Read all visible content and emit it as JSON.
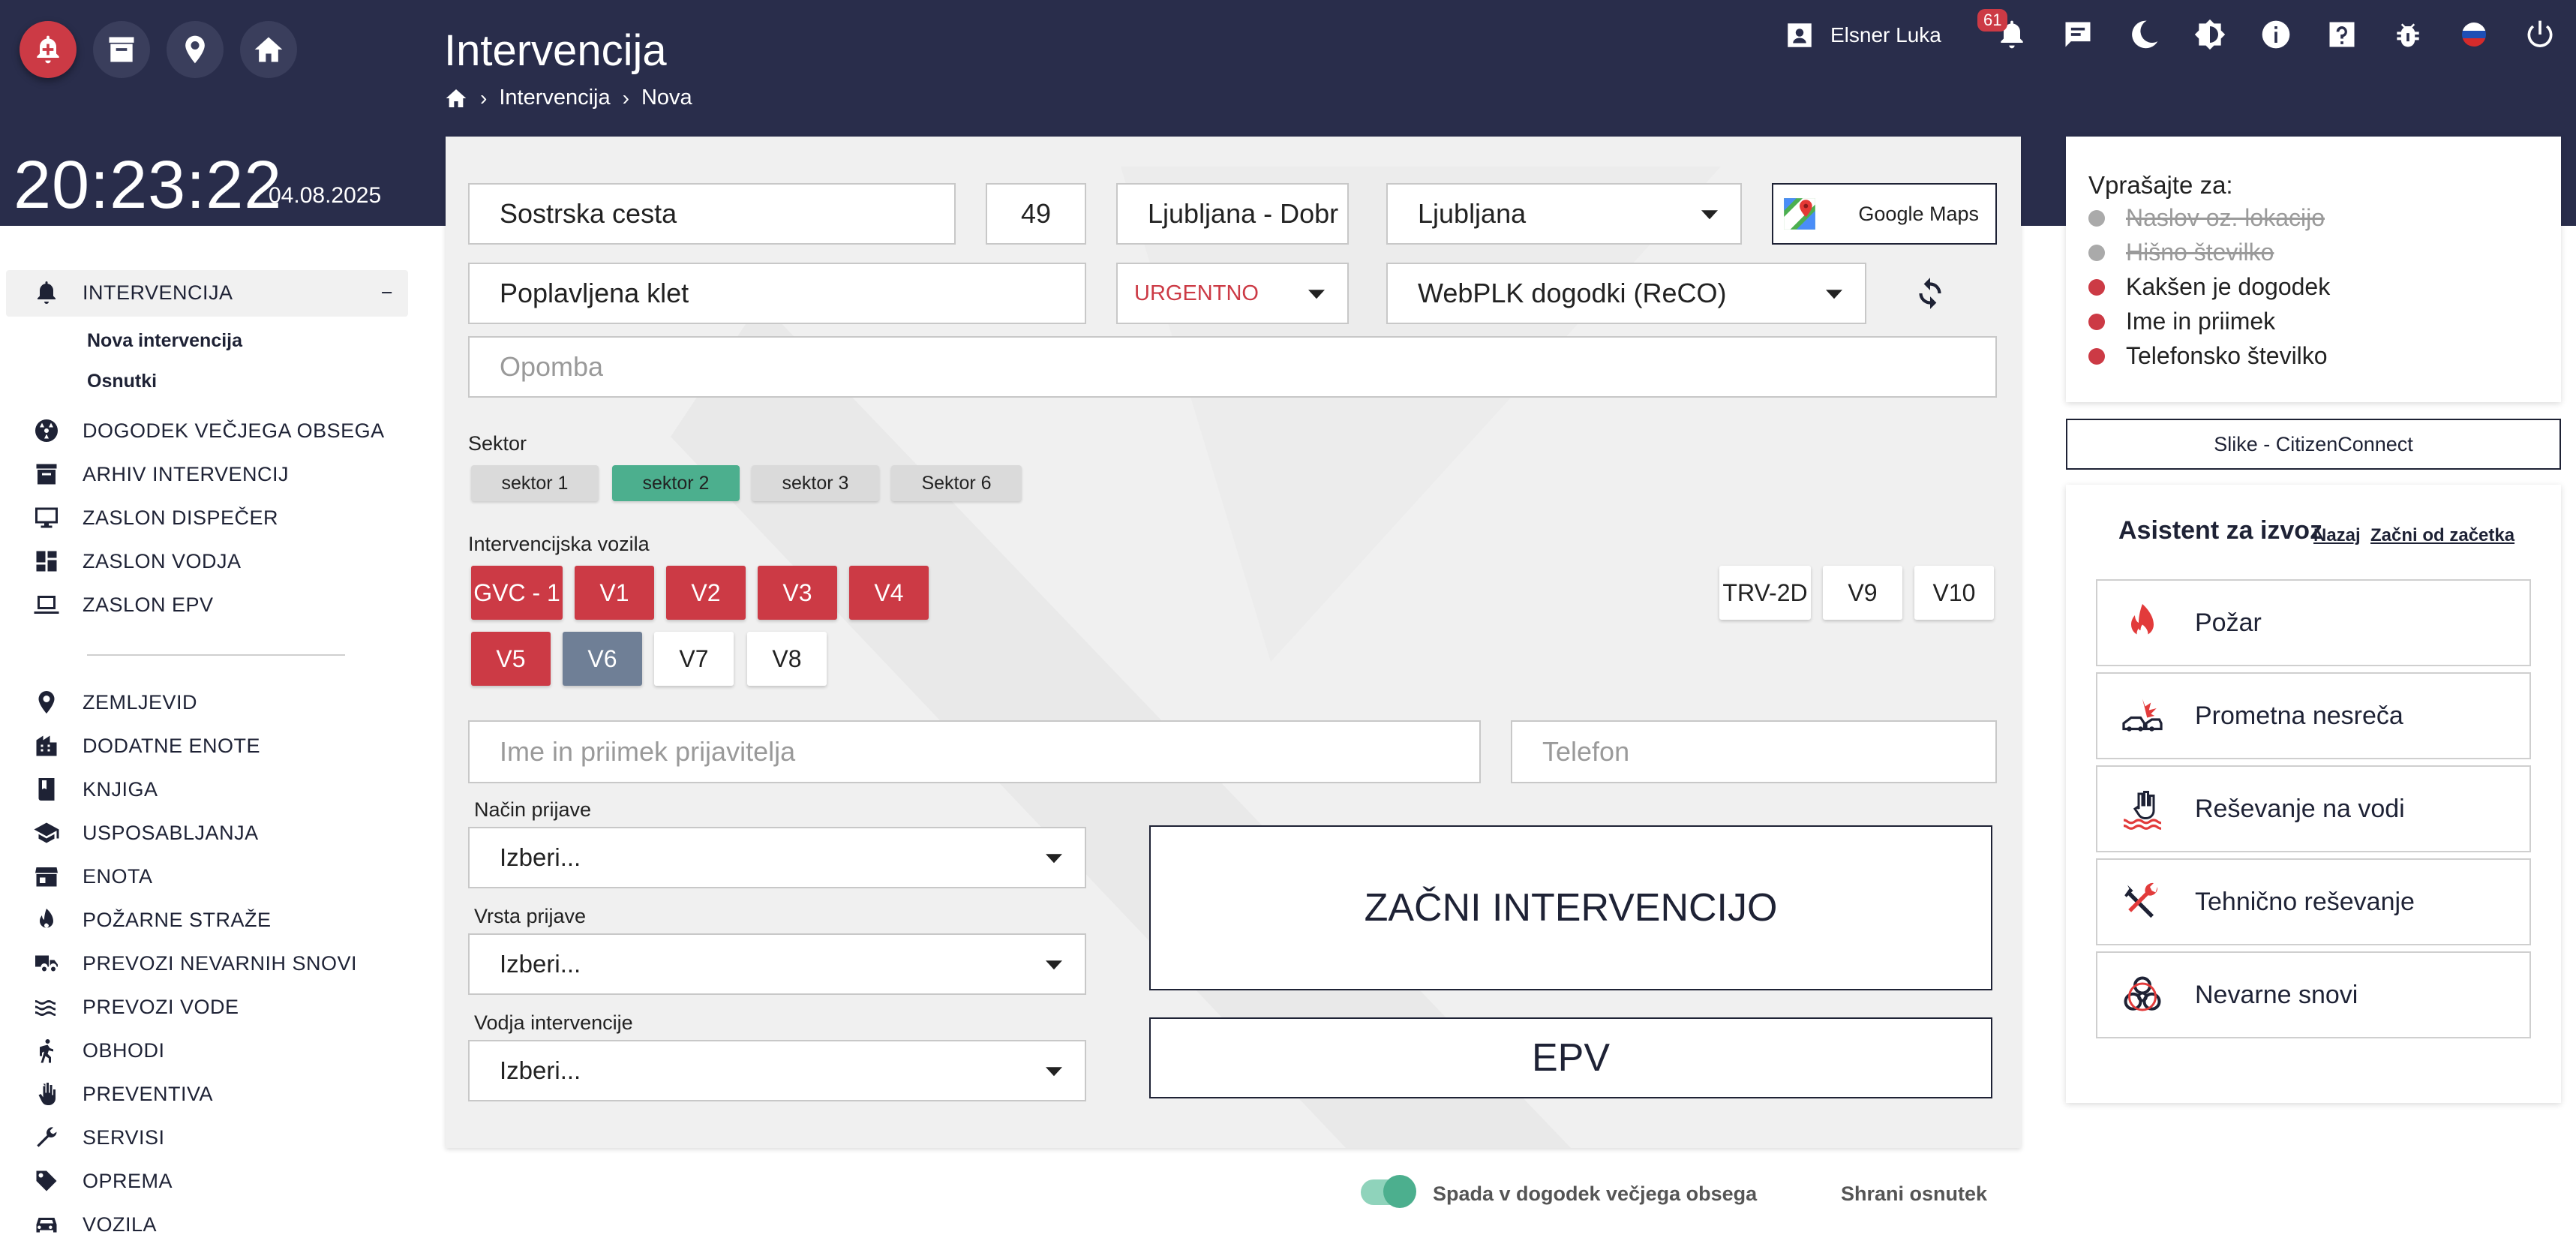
{
  "header": {
    "title": "Intervencija",
    "breadcrumb": [
      "Intervencija",
      "Nova"
    ],
    "time": "20:23:22",
    "date": "04.08.2025",
    "user": "Elsner Luka",
    "notifications": "61"
  },
  "sidebar": {
    "items": [
      {
        "label": "INTERVENCIJA",
        "icon": "alarm-bell-icon"
      },
      {
        "label": "DOGODEK VEČJEGA OBSEGA",
        "icon": "radiation-icon"
      },
      {
        "label": "ARHIV INTERVENCIJ",
        "icon": "archive-icon"
      },
      {
        "label": "ZASLON DISPEČER",
        "icon": "monitor-icon"
      },
      {
        "label": "ZASLON VODJA",
        "icon": "dashboard-icon"
      },
      {
        "label": "ZASLON EPV",
        "icon": "laptop-icon"
      },
      {
        "label": "ZEMLJEVID",
        "icon": "map-pin-icon"
      },
      {
        "label": "DODATNE ENOTE",
        "icon": "building-icon"
      },
      {
        "label": "KNJIGA",
        "icon": "book-icon"
      },
      {
        "label": "USPOSABLJANJA",
        "icon": "school-icon"
      },
      {
        "label": "ENOTA",
        "icon": "store-icon"
      },
      {
        "label": "POŽARNE STRAŽE",
        "icon": "fire-icon"
      },
      {
        "label": "PREVOZI NEVARNIH SNOVI",
        "icon": "truck-icon"
      },
      {
        "label": "PREVOZI VODE",
        "icon": "water-icon"
      },
      {
        "label": "OBHODI",
        "icon": "walk-icon"
      },
      {
        "label": "PREVENTIVA",
        "icon": "hand-icon"
      },
      {
        "label": "SERVISI",
        "icon": "wrench-icon"
      },
      {
        "label": "OPREMA",
        "icon": "tag-icon"
      },
      {
        "label": "VOZILA",
        "icon": "car-icon"
      }
    ],
    "sub_items": [
      "Nova intervencija",
      "Osnutki"
    ],
    "collapse": "−"
  },
  "form": {
    "street": "Sostrska cesta",
    "number": "49",
    "settlement": "Ljubljana - Dobr",
    "municipality": "Ljubljana",
    "maps_label": "Google Maps",
    "event": "Poplavljena klet",
    "priority": "URGENTNO",
    "source": "WebPLK dogodki (ReCO)",
    "note_placeholder": "Opomba",
    "sector_label": "Sektor",
    "sectors": [
      "sektor 1",
      "sektor 2",
      "sektor 3",
      "Sektor 6"
    ],
    "vehicles_label": "Intervencijska vozila",
    "vehicles_row1": [
      "GVC - 1",
      "V1",
      "V2",
      "V3",
      "V4"
    ],
    "vehicles_row2": [
      "V5",
      "V6",
      "V7",
      "V8"
    ],
    "vehicles_right": [
      "TRV-2D",
      "V9",
      "V10"
    ],
    "reporter_placeholder": "Ime in priimek prijavitelja",
    "phone_placeholder": "Telefon",
    "report_method_label": "Način prijave",
    "report_type_label": "Vrsta prijave",
    "leader_label": "Vodja intervencije",
    "select_default": "Izberi...",
    "start_button": "ZAČNI INTERVENCIJO",
    "epv_button": "EPV"
  },
  "ask": {
    "title": "Vprašajte za:",
    "items": [
      {
        "label": "Naslov oz. lokacijo",
        "done": true
      },
      {
        "label": "Hišno številko",
        "done": true
      },
      {
        "label": "Kakšen je dogodek",
        "done": false
      },
      {
        "label": "Ime in priimek",
        "done": false
      },
      {
        "label": "Telefonsko številko",
        "done": false
      }
    ]
  },
  "slike_button": "Slike - CitizenConnect",
  "assistant": {
    "title": "Asistent za izvoz",
    "back": "Nazaj",
    "restart": "Začni od začetka",
    "categories": [
      {
        "label": "Požar",
        "icon": "fire-icon"
      },
      {
        "label": "Prometna nesreča",
        "icon": "car-crash-icon"
      },
      {
        "label": "Reševanje na vodi",
        "icon": "water-rescue-icon"
      },
      {
        "label": "Tehnično reševanje",
        "icon": "tools-icon"
      },
      {
        "label": "Nevarne snovi",
        "icon": "biohazard-icon"
      }
    ]
  },
  "footer": {
    "toggle_label": "Spada v dogodek večjega obsega",
    "save_draft": "Shrani osnutek"
  },
  "colors": {
    "header": "#292d4b",
    "red": "#cc3a45",
    "green": "#4caf8e",
    "gray_vehicle": "#6f7f96"
  }
}
